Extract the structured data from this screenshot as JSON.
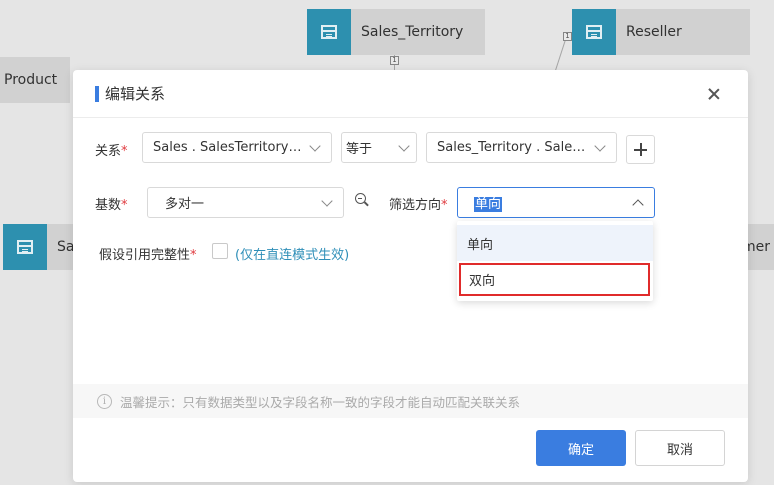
{
  "background": {
    "tables": {
      "territory": "Sales_Territory",
      "reseller": "Reseller",
      "product": "Product",
      "sal": "Sal",
      "mer": "mer"
    },
    "connector_marks": [
      "1",
      "1"
    ]
  },
  "dialog": {
    "title": "编辑关系",
    "relation": {
      "label": "关系",
      "required": "*",
      "left_value": "Sales . SalesTerritoryK...",
      "operator": "等于",
      "right_value": "Sales_Territory . Sales..."
    },
    "cardinality": {
      "label": "基数",
      "required": "*",
      "value": "多对一"
    },
    "filter_direction": {
      "label": "筛选方向",
      "required": "*",
      "value": "单向",
      "options": [
        "单向",
        "双向"
      ]
    },
    "integrity": {
      "label": "假设引用完整性",
      "required": "*",
      "note": "(仅在直连模式生效)"
    },
    "tip": "温馨提示：只有数据类型以及字段名称一致的字段才能自动匹配关联关系",
    "buttons": {
      "ok": "确定",
      "cancel": "取消"
    }
  },
  "colors": {
    "primary": "#3a7de0",
    "table_icon": "#2e93b3",
    "required": "#e0393e",
    "link": "#2f8fb8",
    "highlight_border": "#e02b2b"
  }
}
